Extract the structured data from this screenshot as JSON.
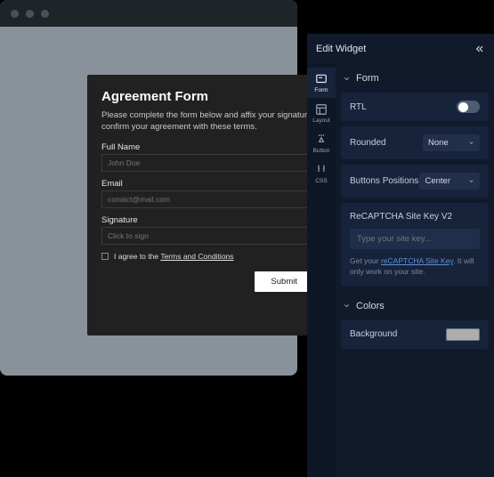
{
  "preview": {
    "form": {
      "title": "Agreement Form",
      "description": "Please complete the form below and affix your signature to confirm your agreement with these terms.",
      "fields": {
        "fullName": {
          "label": "Full Name",
          "placeholder": "John Doe"
        },
        "email": {
          "label": "Email",
          "placeholder": "conatct@mail.com"
        },
        "signature": {
          "label": "Signature",
          "placeholder": "Click to sign"
        }
      },
      "agree": {
        "prefix": "I agree to the ",
        "link": "Terms and Conditions"
      },
      "submit": "Submit"
    }
  },
  "panel": {
    "title": "Edit Widget",
    "tabs": {
      "form": "Form",
      "layout": "Layout",
      "button": "Button",
      "css": "CSS"
    },
    "sections": {
      "form": {
        "heading": "Form",
        "rtl": {
          "label": "RTL",
          "on": false
        },
        "rounded": {
          "label": "Rounded",
          "value": "None"
        },
        "buttonsPositions": {
          "label": "Buttons Positions",
          "value": "Center"
        },
        "recaptcha": {
          "label": "ReCAPTCHA Site Key V2",
          "placeholder": "Type your site key...",
          "helperPrefix": "Get your ",
          "helperLink": "reCAPTCHA Site Key",
          "helperSuffix": ". It will only work on your site."
        }
      },
      "colors": {
        "heading": "Colors",
        "background": {
          "label": "Background",
          "value": "#adadad"
        }
      }
    }
  }
}
